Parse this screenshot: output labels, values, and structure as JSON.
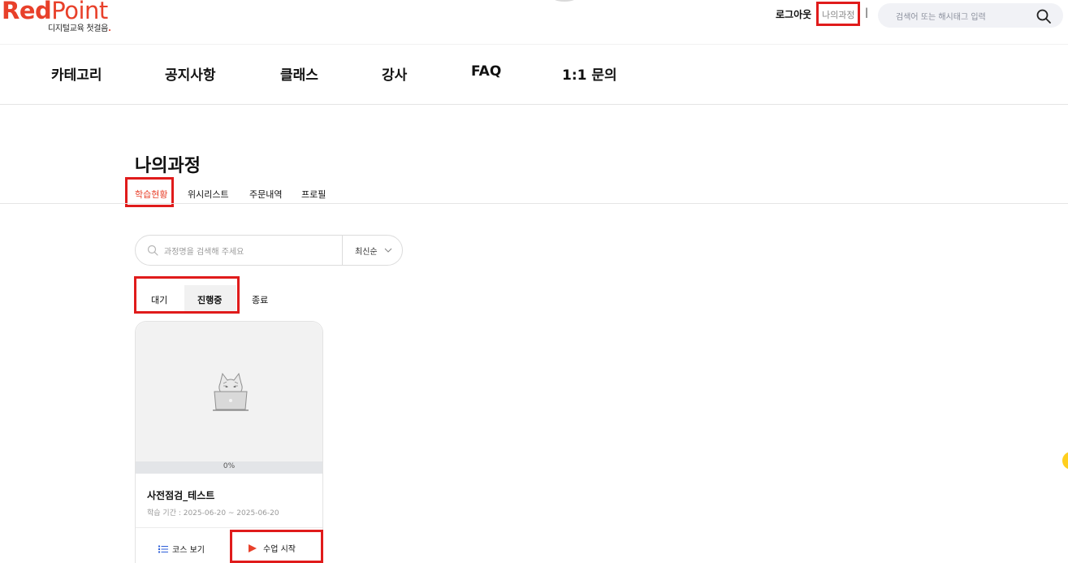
{
  "brand": {
    "name_red": "Red",
    "name_point": "Point",
    "tagline": "디지털교육 첫걸음",
    "tagline_dot": ".",
    "accent": "#e8402a"
  },
  "utility": {
    "logout": "로그아웃",
    "my_course": "나의과정",
    "separator": "|",
    "search_placeholder": "검색어 또는 해시태그 입력"
  },
  "gnb": {
    "items": [
      "카테고리",
      "공지사항",
      "클래스",
      "강사",
      "FAQ",
      "1:1 문의"
    ]
  },
  "page": {
    "title": "나의과정",
    "tabs": [
      "학습현황",
      "위시리스트",
      "주문내역",
      "프로필"
    ],
    "active_tab": "학습현황"
  },
  "filter": {
    "search_placeholder": "과정명을 검색해 주세요",
    "sort_selected": "최신순"
  },
  "status_tabs": {
    "items": [
      "대기",
      "진행중",
      "종료"
    ],
    "active": "진행중"
  },
  "courses": [
    {
      "progress_label": "0%",
      "progress": 0,
      "title": "사전점검_테스트",
      "period": "학습 기간 : 2025-06-20 ~ 2025-06-20",
      "view_course_label": "코스 보기",
      "start_label": "수업 시작"
    }
  ],
  "colors": {
    "highlight_box": "#e01b1b",
    "accent": "#e8402a",
    "floating": "#ffcf1f"
  }
}
